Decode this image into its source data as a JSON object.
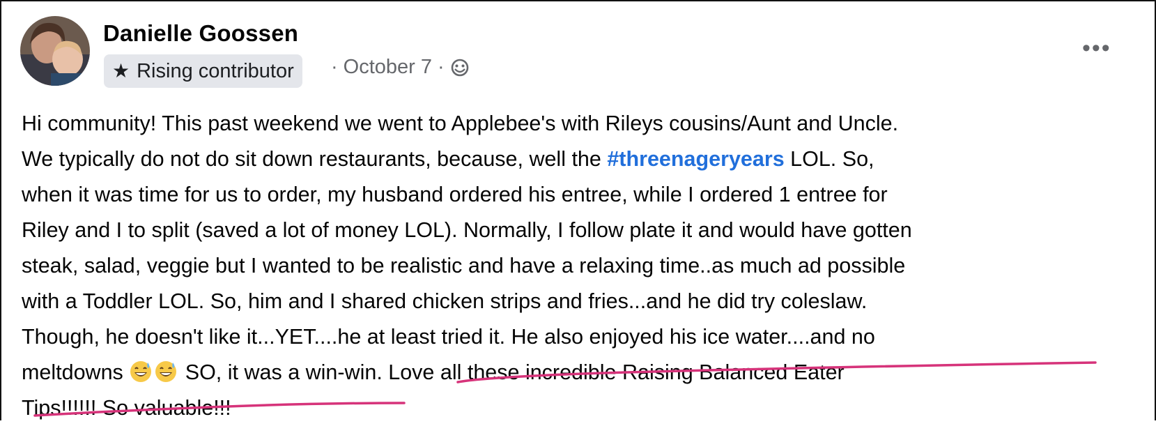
{
  "post": {
    "author": "Danielle Goossen",
    "badge_label": "Rising contributor",
    "date": "October 7",
    "separator": "·",
    "more_label": "•••",
    "hashtag": "#threenageryears",
    "lines": {
      "l1": "Hi community! This past weekend we went to Applebee's with Rileys cousins/Aunt and Uncle.",
      "l2_before": "We typically do not do sit down restaurants, because, well the ",
      "l2_after": " LOL. So,",
      "l3": "when it was time for us to order, my husband ordered his entree, while I ordered 1 entree for",
      "l4": "Riley and I to split (saved a lot of money LOL). Normally, I follow plate it and would have gotten",
      "l5": "steak, salad, veggie but I wanted to be realistic and have a relaxing time..as much ad possible",
      "l6": "with a Toddler LOL. So, him and I shared chicken strips and fries...and he did try coleslaw.",
      "l7": "Though, he doesn't like it...YET....he at least tried it. He also enjoyed his ice water....and no",
      "l8_before": "meltdowns ",
      "l8_after": " SO, it was a win-win. Love all these incredible Raising Balanced Eater",
      "l9": "Tips!!!!!! So valuable!!!"
    },
    "emojis": [
      "grinning-sweat-emoji",
      "grinning-sweat-emoji"
    ],
    "highlight_color": "#d6337a"
  }
}
